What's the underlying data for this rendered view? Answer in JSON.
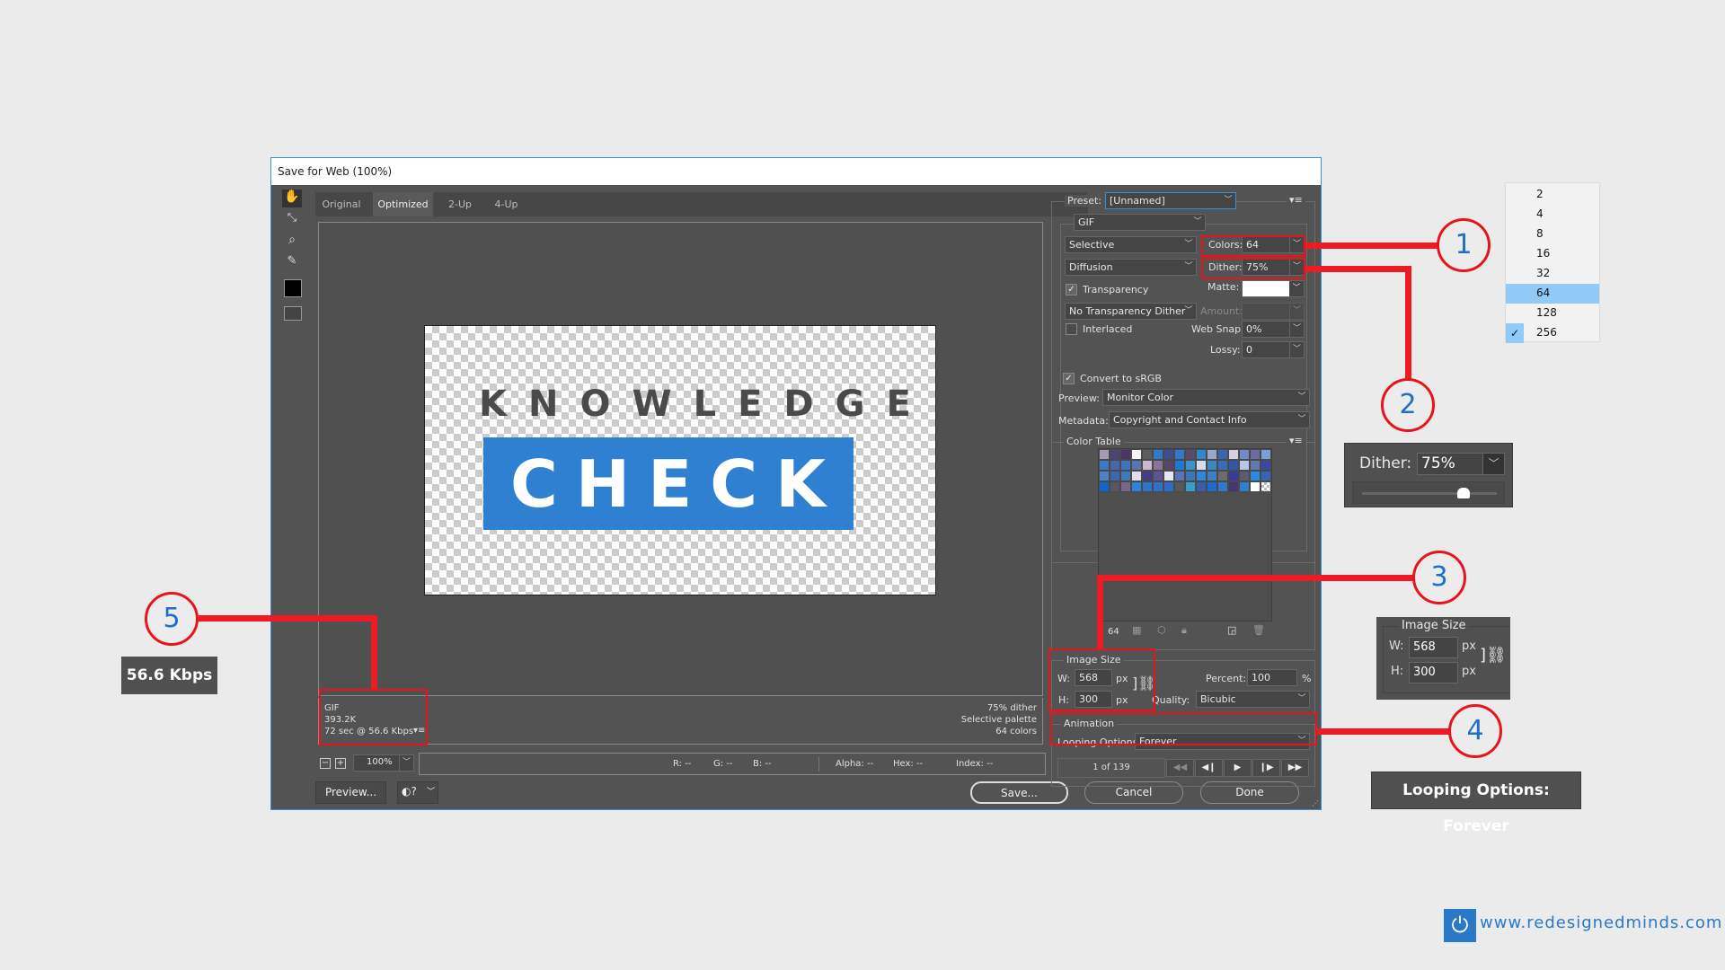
{
  "dialog": {
    "title": "Save for Web (100%)"
  },
  "tabs": [
    {
      "label": "Original"
    },
    {
      "label": "Optimized",
      "active": true
    },
    {
      "label": "2-Up"
    },
    {
      "label": "4-Up"
    }
  ],
  "tools": [
    "hand-icon",
    "slice-select-icon",
    "zoom-icon",
    "eyedropper-icon",
    "color-swatch-icon",
    "toggle-slices-icon"
  ],
  "canvas": {
    "line1": "KNOWLEDGE",
    "line2": "CHECK",
    "accent": "#2f80d0"
  },
  "info_left": {
    "format": "GIF",
    "size": "393.2K",
    "time": "72 sec @ 56.6 Kbps"
  },
  "info_right": {
    "dither": "75% dither",
    "palette": "Selective palette",
    "colors": "64 colors"
  },
  "zoom": {
    "value": "100%"
  },
  "readout": {
    "r": "R: --",
    "g": "G: --",
    "b": "B: --",
    "alpha": "Alpha: --",
    "hex": "Hex: --",
    "index": "Index: --"
  },
  "buttons": {
    "preview": "Preview...",
    "save": "Save...",
    "cancel": "Cancel",
    "done": "Done"
  },
  "settings": {
    "preset_label": "Preset:",
    "preset": "[Unnamed]",
    "format": "GIF",
    "reduction": "Selective",
    "dither_algo": "Diffusion",
    "colors_label": "Colors:",
    "colors": "64",
    "dither_label": "Dither:",
    "dither": "75%",
    "transparency": "Transparency",
    "transparency_checked": true,
    "matte_label": "Matte:",
    "matte_color": "#ffffff",
    "transp_dither": "No Transparency Dither",
    "amount_label": "Amount:",
    "interlaced": "Interlaced",
    "interlaced_checked": false,
    "websnap_label": "Web Snap:",
    "websnap": "0%",
    "lossy_label": "Lossy:",
    "lossy": "0",
    "srgb": "Convert to sRGB",
    "srgb_checked": true,
    "preview_label": "Preview:",
    "preview": "Monitor Color",
    "metadata_label": "Metadata:",
    "metadata": "Copyright and Contact Info"
  },
  "color_table": {
    "title": "Color Table",
    "count": "64",
    "swatches": [
      "#a89ab0",
      "#4e4474",
      "#4a3563",
      "#f3f3f8",
      "#5c5c5c",
      "#2f7ad0",
      "#3e4d8e",
      "#2e79cf",
      "#5c4a6c",
      "#2f86d2",
      "#9aa7c9",
      "#3866b0",
      "#d9cde0",
      "#6f8cc8",
      "#6c6ca4",
      "#7a9fd6",
      "#3a78c8",
      "#4a66a8",
      "#3c74c0",
      "#5a74b0",
      "#c8b8d0",
      "#8c7498",
      "#5a4468",
      "#1f78d4",
      "#3894cc",
      "#d8dcec",
      "#3a88c0",
      "#3a6cb8",
      "#3456a8",
      "#b8c8e4",
      "#6478b0",
      "#3c48a0",
      "#5080c8",
      "#3c68b0",
      "#3c7cb4",
      "#e4dce8",
      "#443c88",
      "#5c5494",
      "#e8e8f4",
      "#5c74b4",
      "#3878b8",
      "#2e88d8",
      "#3a80c8",
      "#6c6c6c",
      "#383c98",
      "#5c5c6c",
      "#2a8ae0",
      "#3a64b0",
      "#1464c8",
      "#5a5460",
      "#7c6488",
      "#2e80d8",
      "#2c74cc",
      "#3070c8",
      "#2c6cc4",
      "#585858",
      "#38a0c8",
      "#3c5ca8",
      "#1c6cd0",
      "#3078c8",
      "#443870",
      "#2e7ed4",
      "#ffffff",
      "transparent"
    ]
  },
  "image_size": {
    "title": "Image Size",
    "w_label": "W:",
    "w": "568",
    "h_label": "H:",
    "h": "300",
    "unit": "px",
    "percent_label": "Percent:",
    "percent": "100",
    "percent_unit": "%",
    "quality_label": "Quality:",
    "quality": "Bicubic"
  },
  "animation": {
    "title": "Animation",
    "looping_label": "Looping Options:",
    "looping": "Forever",
    "frame": "1 of 139"
  },
  "callouts": {
    "n1": "1",
    "n2": "2",
    "n3": "3",
    "n4": "4",
    "n5": "5",
    "kbps": "56.6 Kbps",
    "looping": "Looping Options: Forever",
    "color": "#e8141c"
  },
  "colors_menu": {
    "items": [
      "2",
      "4",
      "8",
      "16",
      "32",
      "64",
      "128",
      "256"
    ],
    "highlighted": "64",
    "checked": "256"
  },
  "dither_inset": {
    "label": "Dither:",
    "value": "75%",
    "slider_percent": 75
  },
  "size_inset": {
    "title": "Image Size",
    "w_label": "W:",
    "w": "568",
    "h_label": "H:",
    "h": "300",
    "unit": "px"
  },
  "brand": {
    "url": "www.redesignedminds.com",
    "color": "#2a78c8"
  }
}
